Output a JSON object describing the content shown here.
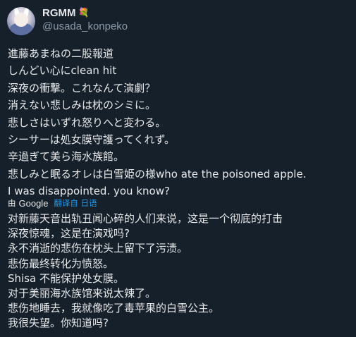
{
  "author": {
    "display_name": "RGMM",
    "badge_icon": "bouquet-emoji",
    "handle": "@usada_konpeko"
  },
  "tweet": {
    "lines": [
      "進藤あまねの二股報道",
      "しんどい心にclean hit",
      "深夜の衝撃。これなんて演劇？",
      "消えない悲しみは枕のシミに。",
      "悲しさはいずれ怒りへと変わる。",
      "シーサーは処女膜守護ってくれず。",
      "辛過ぎて美ら海水族館。",
      "悲しみと眠るオレは白雪姫の様who ate the poisoned apple.",
      "I was disappointed. you know?"
    ]
  },
  "translation": {
    "by_label": "由",
    "provider": "Google",
    "link_label": "翻译自 日语",
    "lines": [
      "对新藤天音出轨丑闻心碎的人们来说，这是一个彻底的打击",
      "深夜惊魂，这是在演戏吗?",
      "永不消逝的悲伤在枕头上留下了污渍。",
      "悲伤最终转化为愤怒。",
      "Shisa 不能保护处女膜。",
      "对于美丽海水族馆来说太辣了。",
      "悲伤地睡去，我就像吃了毒苹果的白雪公主。",
      "我很失望。你知道吗?"
    ]
  },
  "colors": {
    "background": "#15202b",
    "text": "#e7e9ea",
    "secondary": "#8b98a5",
    "link": "#1d9bf0"
  }
}
